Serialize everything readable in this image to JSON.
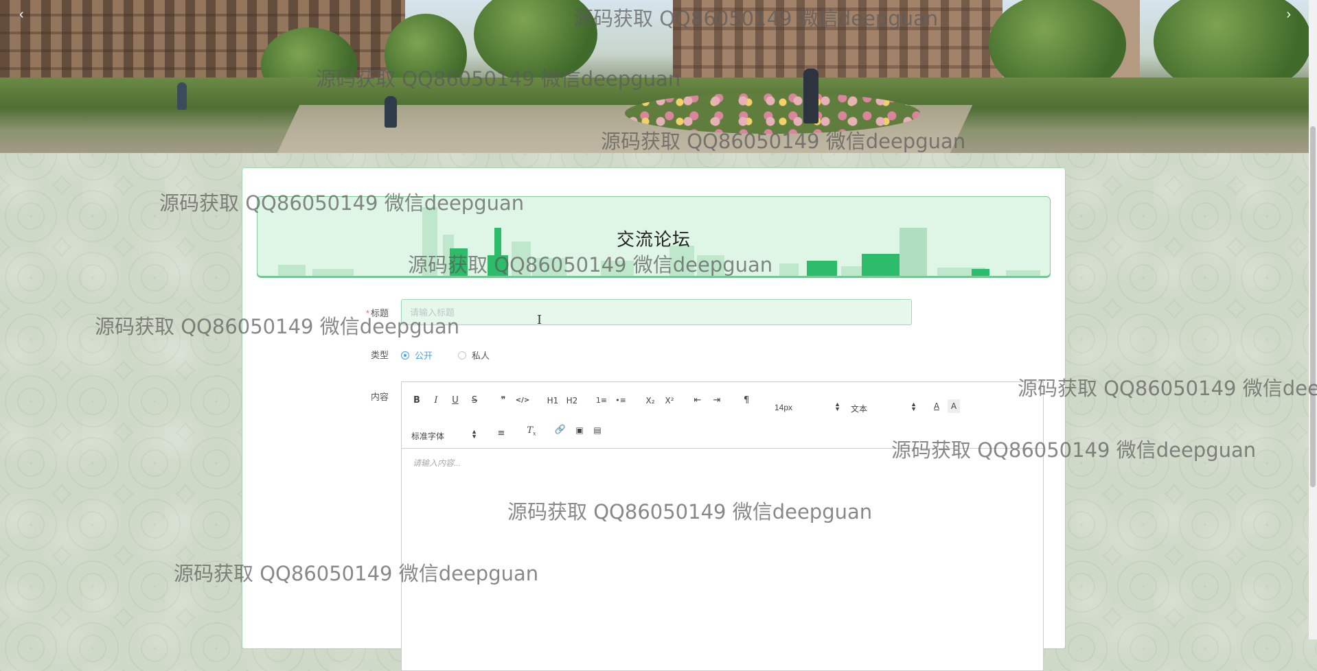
{
  "carousel": {
    "prev_icon": "‹",
    "next_icon": "›"
  },
  "page": {
    "title": "交流论坛"
  },
  "form": {
    "title_label": "标题",
    "required_mark": "*",
    "title_placeholder": "请输入标题",
    "type_label": "类型",
    "type_options": [
      "公开",
      "私人"
    ],
    "type_selected": "公开",
    "content_label": "内容"
  },
  "editor": {
    "toolbar": {
      "bold": "B",
      "italic": "I",
      "underline": "U",
      "strike": "S",
      "blockquote": "❞",
      "code": "</>",
      "h1": "H1",
      "h2": "H2",
      "ordered_list": "1≡",
      "bullet_list": "•≡",
      "subscript": "X₂",
      "superscript": "X²",
      "outdent": "⇤",
      "indent": "⇥",
      "direction": "¶",
      "font_size": "14px",
      "header_select": "文本",
      "font_family": "标准字体"
    },
    "placeholder": "请输入内容..."
  },
  "watermark_text": "源码获取 QQ86050149 微信deepguan",
  "colors": {
    "accent_green": "#2dbd6a",
    "radio_blue": "#409eff",
    "required_red": "#f56c6c"
  }
}
